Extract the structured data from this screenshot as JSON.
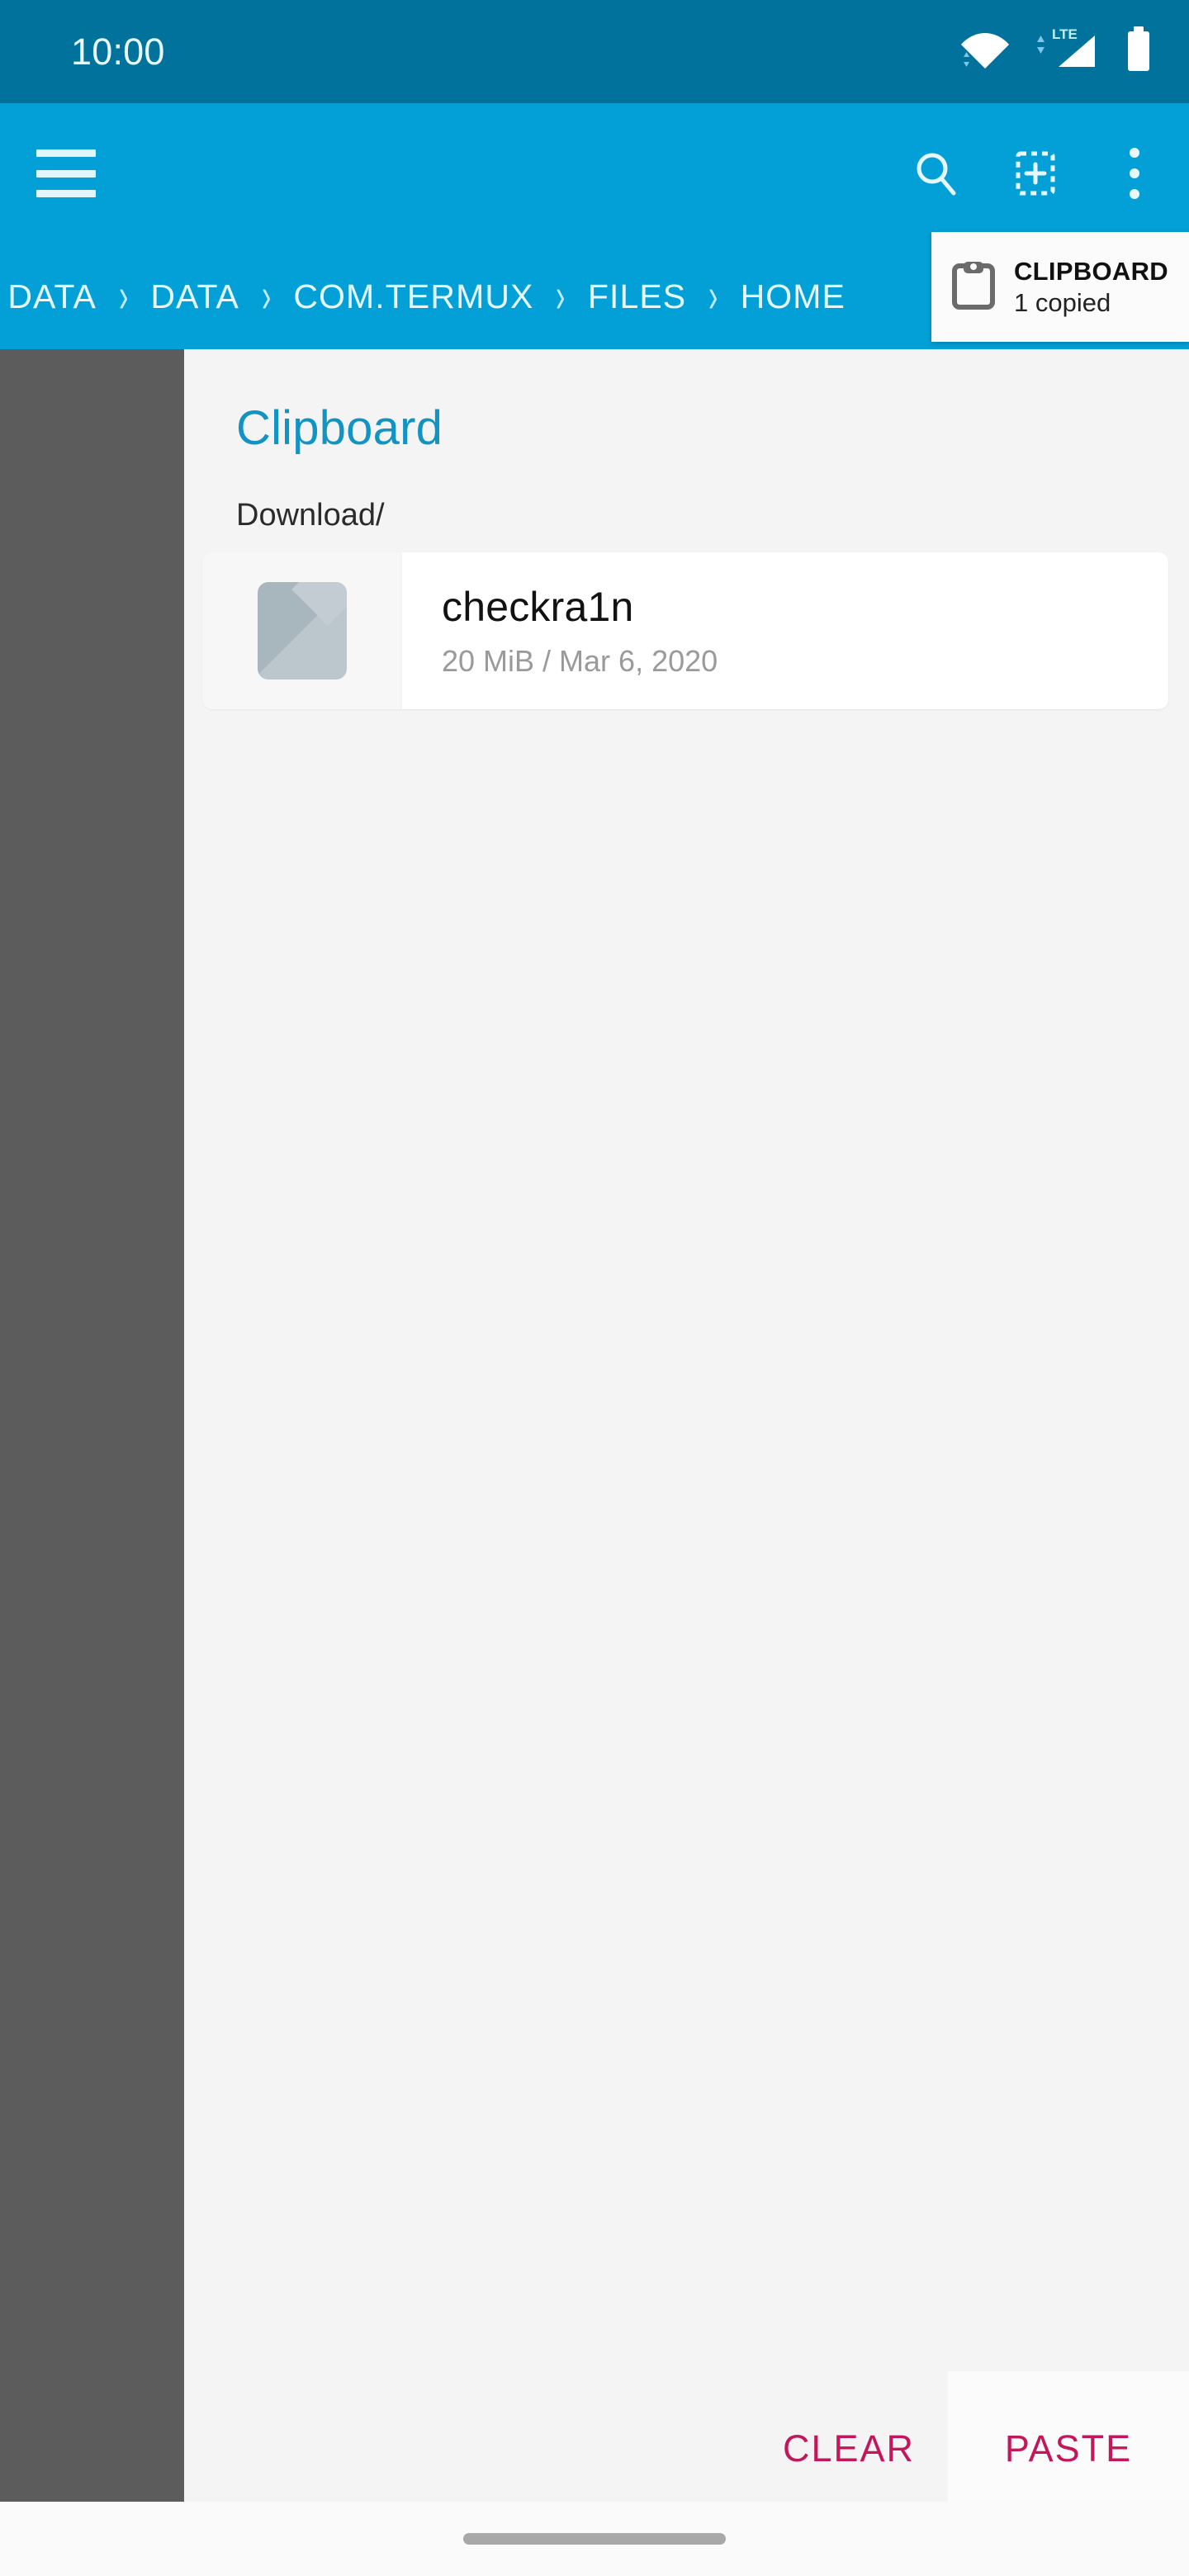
{
  "status_bar": {
    "time": "10:00",
    "icons": [
      "wifi-icon",
      "lte-signal-icon",
      "battery-icon"
    ],
    "network_label": "LTE",
    "background": "#00729b"
  },
  "toolbar": {
    "background": "#03a0d7",
    "menu_icon": "hamburger-menu-icon",
    "actions": [
      {
        "icon": "search-icon",
        "label": "Search"
      },
      {
        "icon": "new-folder-icon",
        "label": "New"
      },
      {
        "icon": "overflow-menu-icon",
        "label": "More options"
      }
    ]
  },
  "breadcrumb": {
    "separator": "›",
    "items": [
      "DATA",
      "DATA",
      "COM.TERMUX",
      "FILES",
      "HOME"
    ]
  },
  "clipboard_popup": {
    "icon": "clipboard-icon",
    "title": "CLIPBOARD",
    "subtitle": "1 copied"
  },
  "sheet": {
    "title": "Clipboard",
    "title_color": "#1193c4",
    "path": "Download/",
    "files": [
      {
        "name": "checkra1n",
        "size": "20 MiB",
        "date": "Mar 6, 2020",
        "meta": "20 MiB / Mar 6, 2020",
        "thumbnail": "file-thumbnail-icon"
      }
    ],
    "actions": [
      {
        "label": "CLEAR",
        "color": "#c2185b"
      },
      {
        "label": "PASTE",
        "color": "#c2185b"
      }
    ]
  },
  "navigation_bar": {
    "gesture_pill": "home-gesture-pill"
  }
}
